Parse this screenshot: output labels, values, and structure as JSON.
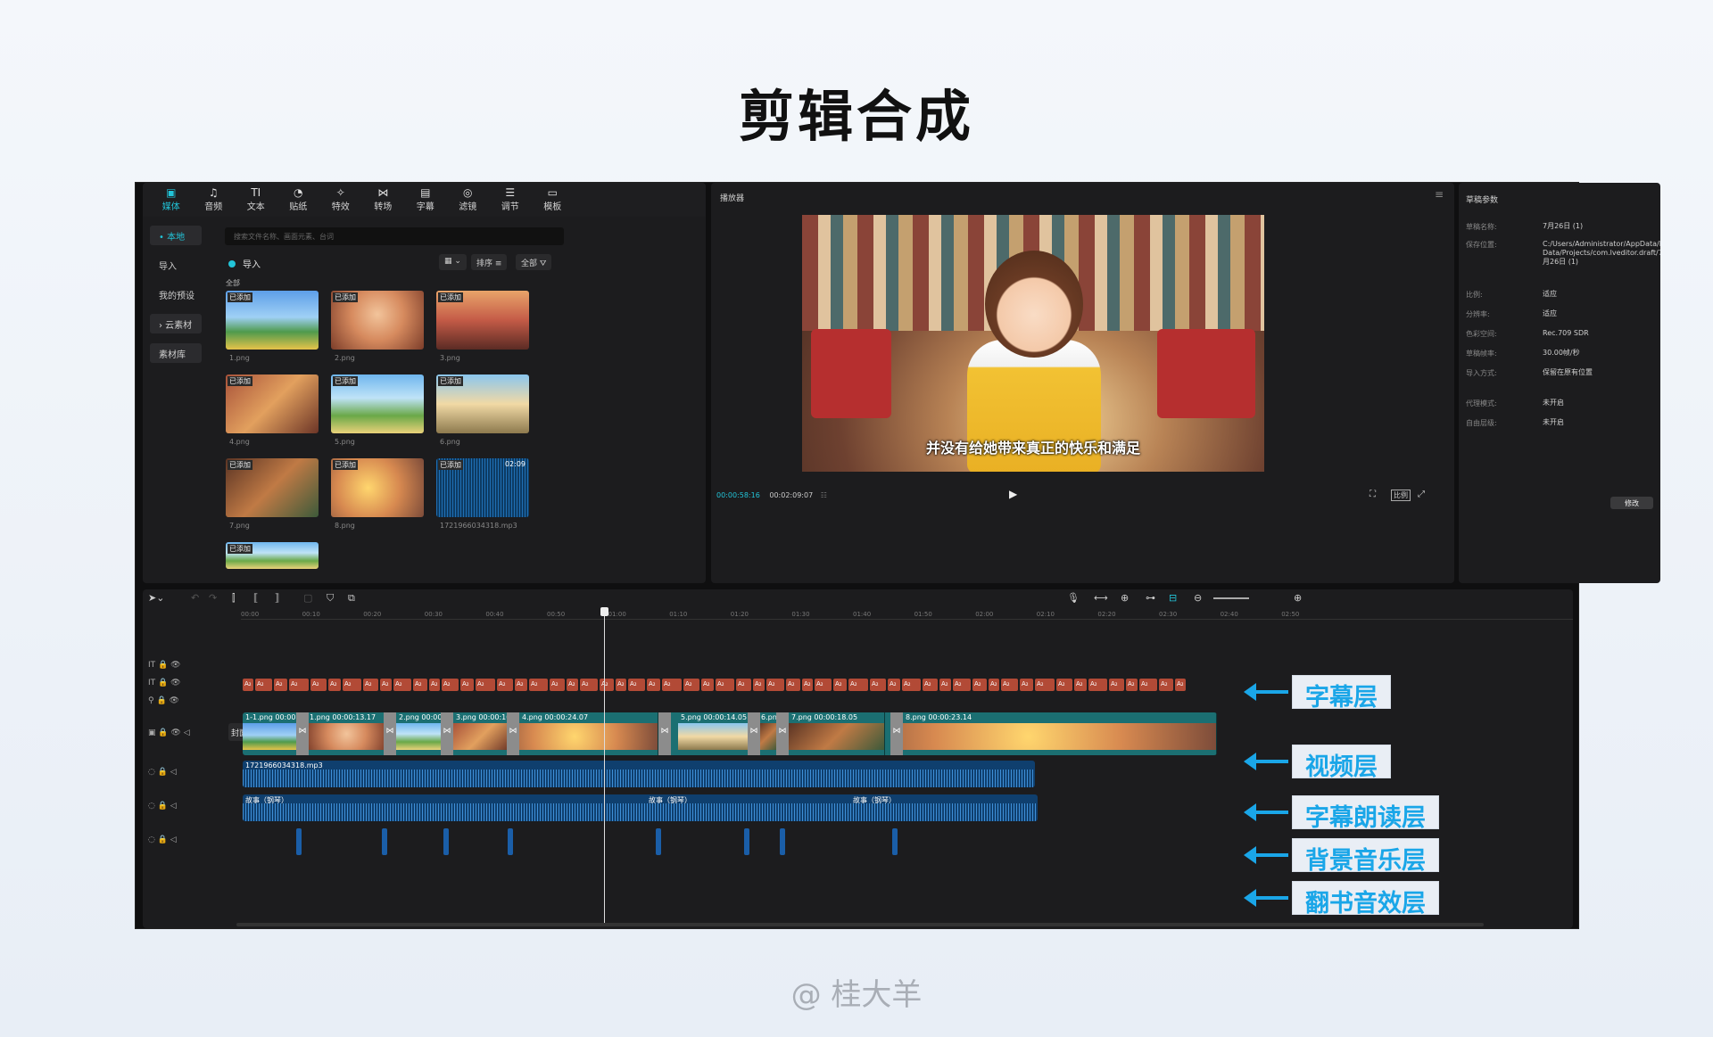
{
  "header": {
    "title": "剪辑合成"
  },
  "footer": {
    "credit": "@ 桂大羊"
  },
  "media": {
    "tabs": [
      {
        "icon": "media-icon",
        "glyph": "▣",
        "label": "媒体"
      },
      {
        "icon": "audio-icon",
        "glyph": "♫",
        "label": "音频"
      },
      {
        "icon": "text-icon",
        "glyph": "TI",
        "label": "文本"
      },
      {
        "icon": "sticker-icon",
        "glyph": "◔",
        "label": "贴纸"
      },
      {
        "icon": "effects-icon",
        "glyph": "✧",
        "label": "特效"
      },
      {
        "icon": "transition-icon",
        "glyph": "⋈",
        "label": "转场"
      },
      {
        "icon": "caption-icon",
        "glyph": "▤",
        "label": "字幕"
      },
      {
        "icon": "filter-icon",
        "glyph": "◎",
        "label": "滤镜"
      },
      {
        "icon": "adjust-icon",
        "glyph": "☰",
        "label": "调节"
      },
      {
        "icon": "template-icon",
        "glyph": "▭",
        "label": "模板"
      }
    ],
    "side": [
      "• 本地",
      "导入",
      "我的预设",
      "› 云素材",
      "素材库"
    ],
    "search_placeholder": "搜索文件名称、画面元素、台词",
    "import_label": "导入",
    "view_label": "▦ ⌄",
    "sort_label": "排序 ≡",
    "filter_label": "全部 ⛛",
    "all_label": "全部",
    "added_badge": "已添加",
    "items": [
      {
        "name": "1.png"
      },
      {
        "name": "2.png"
      },
      {
        "name": "3.png"
      },
      {
        "name": "4.png"
      },
      {
        "name": "5.png"
      },
      {
        "name": "6.png"
      },
      {
        "name": "7.png"
      },
      {
        "name": "8.png"
      },
      {
        "name": "1721966034318.mp3",
        "duration": "02:09"
      }
    ]
  },
  "player": {
    "title": "播放器",
    "subtitle": "并没有给她带来真正的快乐和满足",
    "current_time": "00:00:58:16",
    "total_time": "00:02:09:07",
    "ratio_label": "比例"
  },
  "props": {
    "title": "草稿参数",
    "rows": [
      {
        "label": "草稿名称:",
        "value": "7月26日 (1)"
      },
      {
        "label": "保存位置:",
        "value": "C:/Users/Administrator/AppData/Local/JianyingPro/User Data/Projects/com.lveditor.draft/7月26日 (1)"
      },
      {
        "label": "比例:",
        "value": "适应"
      },
      {
        "label": "分辨率:",
        "value": "适应"
      },
      {
        "label": "色彩空间:",
        "value": "Rec.709 SDR"
      },
      {
        "label": "草稿帧率:",
        "value": "30.00帧/秒"
      },
      {
        "label": "导入方式:",
        "value": "保留在原有位置"
      },
      {
        "label": "代理模式:",
        "value": "未开启"
      },
      {
        "label": "自由层级:",
        "value": "未开启"
      }
    ],
    "modify_label": "修改"
  },
  "timeline": {
    "ruler": [
      "00:00",
      "00:10",
      "00:20",
      "00:30",
      "00:40",
      "00:50",
      "01:00",
      "01:10",
      "01:20",
      "01:30",
      "01:40",
      "01:50",
      "02:00",
      "02:10",
      "02:20",
      "02:30",
      "02:40",
      "02:50"
    ],
    "cover_label": "封面",
    "subtitle_chip": "A₂",
    "video_clips": [
      {
        "label": "1-1.png  00:00.0"
      },
      {
        "label": "1.png  00:00:13.17"
      },
      {
        "label": "2.png  00:00.0"
      },
      {
        "label": "3.png  00:00:10"
      },
      {
        "label": "4.png  00:00:24.07"
      },
      {
        "label": "5.png  00:00:14.05"
      },
      {
        "label": "6.png"
      },
      {
        "label": "7.png  00:00:18.05"
      },
      {
        "label": "8.png  00:00:23.14"
      }
    ],
    "voice_label": "1721966034318.mp3",
    "music_label": "故事（钢琴）"
  },
  "annotations": [
    "字幕层",
    "视频层",
    "字幕朗读层",
    "背景音乐层",
    "翻书音效层"
  ]
}
